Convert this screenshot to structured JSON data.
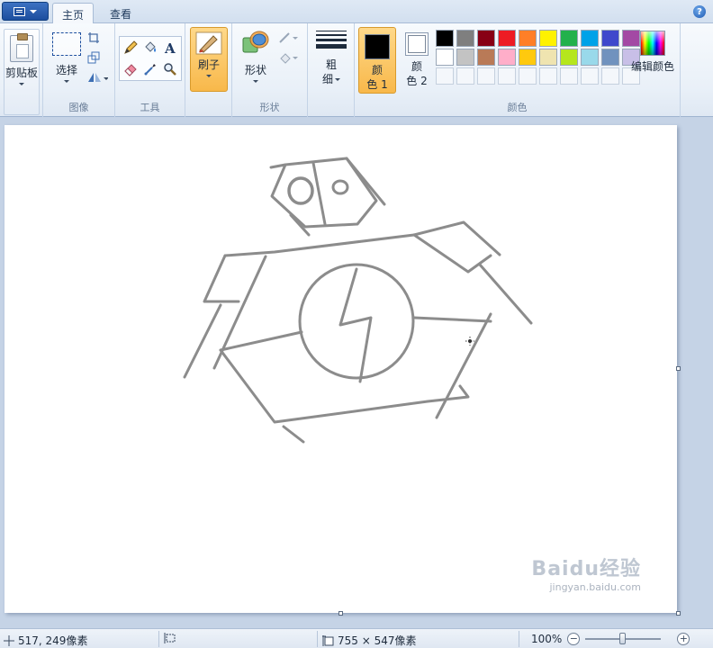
{
  "tabs": {
    "home": "主页",
    "view": "查看"
  },
  "ribbon": {
    "clipboard_label": "剪贴板",
    "image_group": "图像",
    "select_label": "选择",
    "tools_group": "工具",
    "brush_label": "刷子",
    "shapes_label": "形状",
    "shapes_group": "形状",
    "thickness_line1": "粗",
    "thickness_line2": "细",
    "color1_line1": "颜",
    "color1_line2": "色 1",
    "color2_line1": "颜",
    "color2_line2": "色 2",
    "colors_group": "颜色",
    "edit_colors_label": "编辑颜色",
    "color1_value": "#000000",
    "color2_value": "#ffffff"
  },
  "palette": [
    "#000000",
    "#7f7f7f",
    "#880015",
    "#ed1c24",
    "#ff7f27",
    "#fff200",
    "#22b14c",
    "#00a2e8",
    "#3f48cc",
    "#a349a4",
    "#ffffff",
    "#c3c3c3",
    "#b97a57",
    "#ffaec9",
    "#ffc90e",
    "#efe4b0",
    "#b5e61d",
    "#99d9ea",
    "#7092be",
    "#c8bfe7"
  ],
  "status": {
    "cursor_position": "517, 249像素",
    "selection_size": "",
    "canvas_size": "755 × 547像素",
    "zoom": "100%",
    "zoom_minus": "−",
    "zoom_plus": "+"
  },
  "watermark": {
    "brand": "Baidu经验",
    "url": "jingyan.baidu.com"
  },
  "drawing": {
    "stroke_color": "#8c8c8c",
    "description_icons": [
      "robot-head",
      "body",
      "lightning-circle"
    ]
  }
}
